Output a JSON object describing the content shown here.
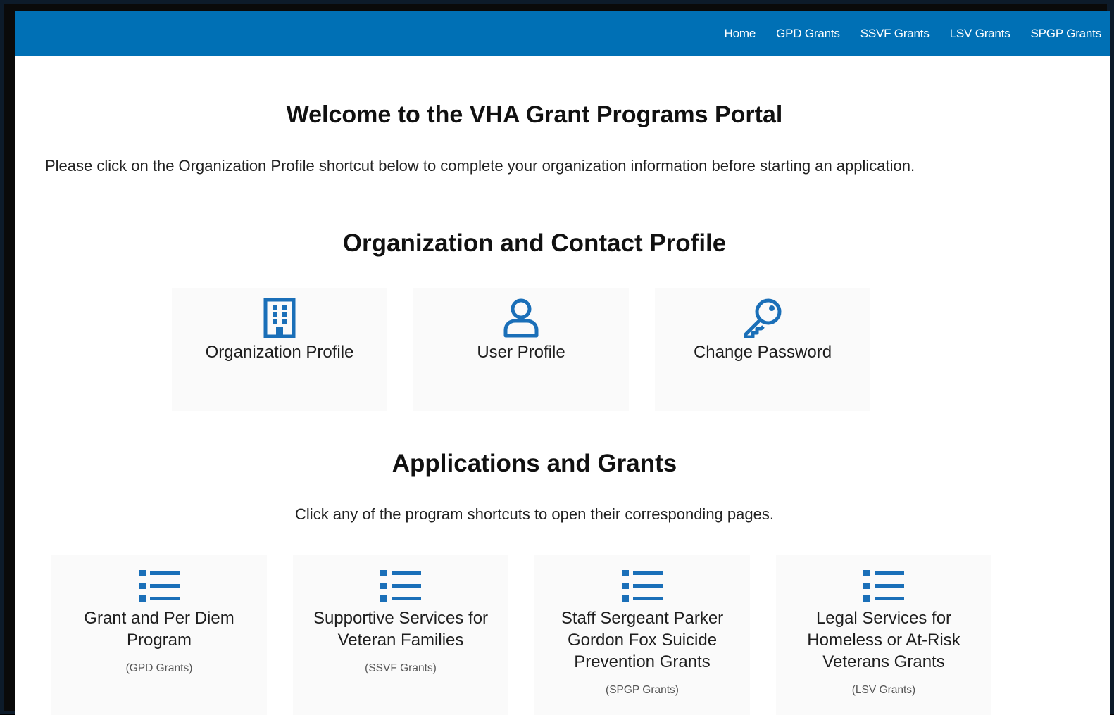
{
  "nav": {
    "links": [
      "Home",
      "GPD Grants",
      "SSVF Grants",
      "LSV Grants",
      "SPGP Grants"
    ]
  },
  "page": {
    "title": "Welcome to the VHA Grant Programs Portal",
    "intro": "Please click on the Organization Profile shortcut below to complete your organization information before starting an application."
  },
  "profile_section": {
    "heading": "Organization and Contact Profile",
    "cards": [
      {
        "label": "Organization Profile",
        "icon": "building-icon"
      },
      {
        "label": "User Profile",
        "icon": "user-icon"
      },
      {
        "label": "Change Password",
        "icon": "key-icon"
      }
    ]
  },
  "grants_section": {
    "heading": "Applications and Grants",
    "subtext": "Click any of the program shortcuts to open their corresponding pages.",
    "cards": [
      {
        "label": "Grant and Per Diem Program",
        "sub": "(GPD Grants)",
        "icon": "list-icon"
      },
      {
        "label": "Supportive Services for Veteran Families",
        "sub": "(SSVF Grants)",
        "icon": "list-icon"
      },
      {
        "label": "Staff Sergeant Parker Gordon Fox Suicide Prevention Grants",
        "sub": "(SPGP Grants)",
        "icon": "list-icon"
      },
      {
        "label": "Legal Services for Homeless or At-Risk Veterans Grants",
        "sub": "(LSV Grants)",
        "icon": "list-icon"
      }
    ]
  },
  "colors": {
    "brand_blue": "#0070b5",
    "icon_blue": "#1a6fb8",
    "card_bg": "#fafafa"
  }
}
